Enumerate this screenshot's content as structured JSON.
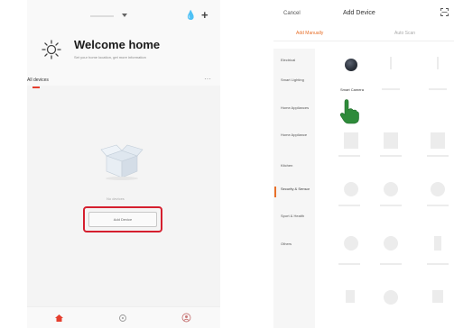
{
  "left_screen": {
    "title": "Welcome home",
    "subtitle": "Set your home location, get more information",
    "tab_all_devices": "All devices",
    "more_glyph": "···",
    "empty_text": "No devices",
    "add_device_button": "Add Device",
    "header_drop_glyph": "💧",
    "header_plus_glyph": "+",
    "accent_color": "#e53e2e",
    "highlight_color": "#d51f2e",
    "nav": {
      "icons": [
        "home-icon",
        "scene-icon",
        "profile-icon"
      ]
    }
  },
  "right_screen": {
    "cancel": "Cancel",
    "title": "Add Device",
    "tabs": {
      "manual": "Add Manually",
      "auto": "Auto Scan"
    },
    "categories": [
      "Electrical",
      "Smart Lighting",
      "Home Appliances",
      "Home Appliance",
      "Kitchen",
      "Security & Sensor",
      "Sport & Health",
      "Others"
    ],
    "selected_category": "Security & Sensor",
    "device": "Smart Camera",
    "accent_color": "#e8702a",
    "pointer_color": "#2e8b3a"
  }
}
